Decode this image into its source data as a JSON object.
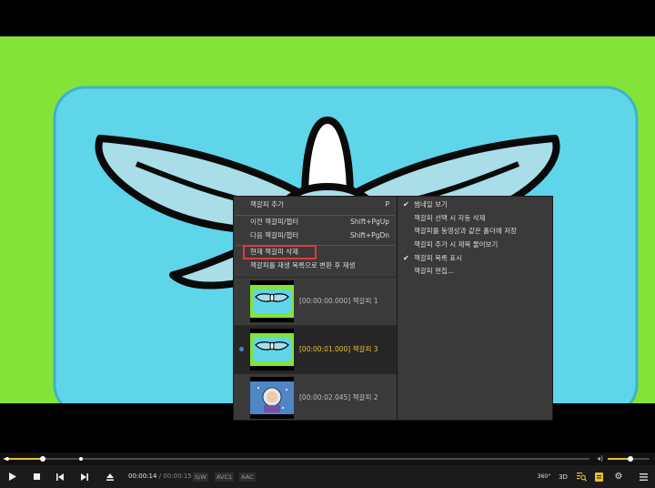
{
  "context_menu": {
    "add_bookmark": "책갈피 추가",
    "add_bookmark_shortcut": "P",
    "prev_bookmark": "이전 책갈피/챕터",
    "prev_bookmark_shortcut": "Shift+PgUp",
    "next_bookmark": "다음 책갈피/챕터",
    "next_bookmark_shortcut": "Shift+PgDn",
    "delete_current": "현재 책갈피 삭제",
    "convert_to_playlist": "책갈피를 재생 목록으로 변환 후 재생",
    "bookmarks": [
      {
        "time": "[00:00:00.000]",
        "name": "책갈피 1",
        "active": false
      },
      {
        "time": "[00:00:01.000]",
        "name": "책갈피 3",
        "active": true
      },
      {
        "time": "[00:00:02.045]",
        "name": "책갈피 2",
        "active": false
      }
    ]
  },
  "sub_menu": {
    "items": [
      {
        "label": "썸네일 보기",
        "checked": true
      },
      {
        "label": "책갈피 선택 시 자동 삭제",
        "checked": false
      },
      {
        "label": "책갈피를 동영상과 같은 폴더에 저장",
        "checked": false
      },
      {
        "label": "책갈피 추가 시 제목 물어보기",
        "checked": false
      },
      {
        "label": "책갈피 목록 표시",
        "checked": true
      },
      {
        "label": "책갈피 편집...",
        "checked": false
      }
    ]
  },
  "player": {
    "current_time": "00:00:14",
    "separator": "/",
    "total_time": "00:00:15",
    "tag_sw": "S/W",
    "tag_video": "AVC1",
    "tag_audio": "AAC",
    "btn_360": "360°",
    "btn_3d": "3D",
    "seek_progress": 0.066,
    "volume_level": 0.55
  },
  "colors": {
    "video_green": "#84e338",
    "visor_cyan": "#5fd5ea",
    "wing_blue": "#a9dde8",
    "highlight_red": "#e0393e",
    "accent_yellow": "#e6c232",
    "bookmark_dot": "#4a7fd4"
  }
}
